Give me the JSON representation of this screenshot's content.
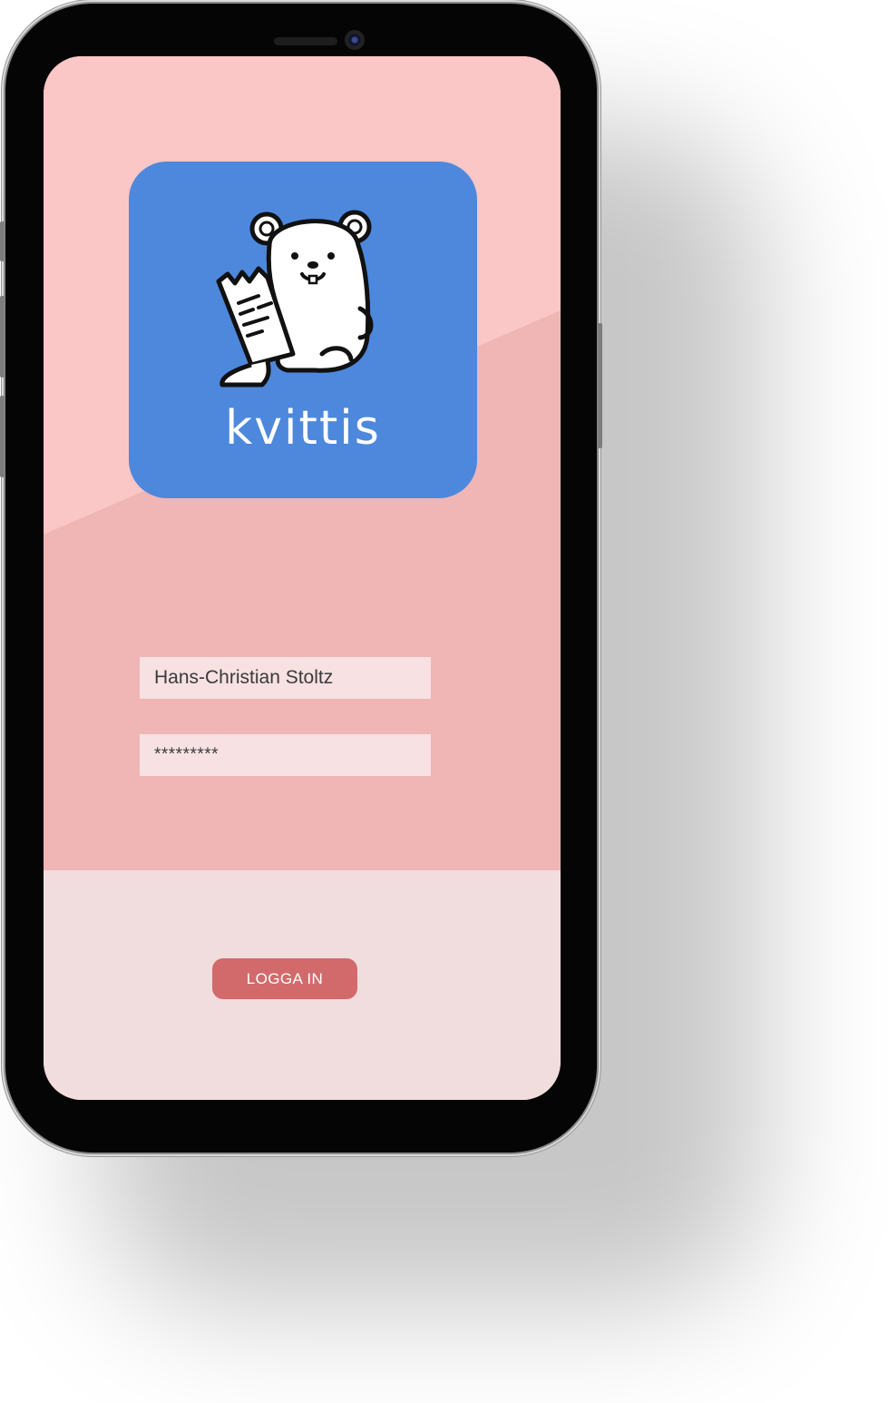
{
  "app": {
    "name": "kvittis",
    "logo_icon": "bear-with-receipt-icon"
  },
  "login_form": {
    "username_value": "Hans-Christian Stoltz",
    "password_value": "*********",
    "submit_label": "LOGGA IN"
  },
  "colors": {
    "screen_background": "#f0b5b5",
    "screen_highlight": "#fbc6c6",
    "bottom_panel": "#f1dcde",
    "app_icon_blue": "#4d88dd",
    "input_background": "#f7e1e2",
    "button_background": "#d26a6b",
    "button_text": "#ffffff"
  }
}
